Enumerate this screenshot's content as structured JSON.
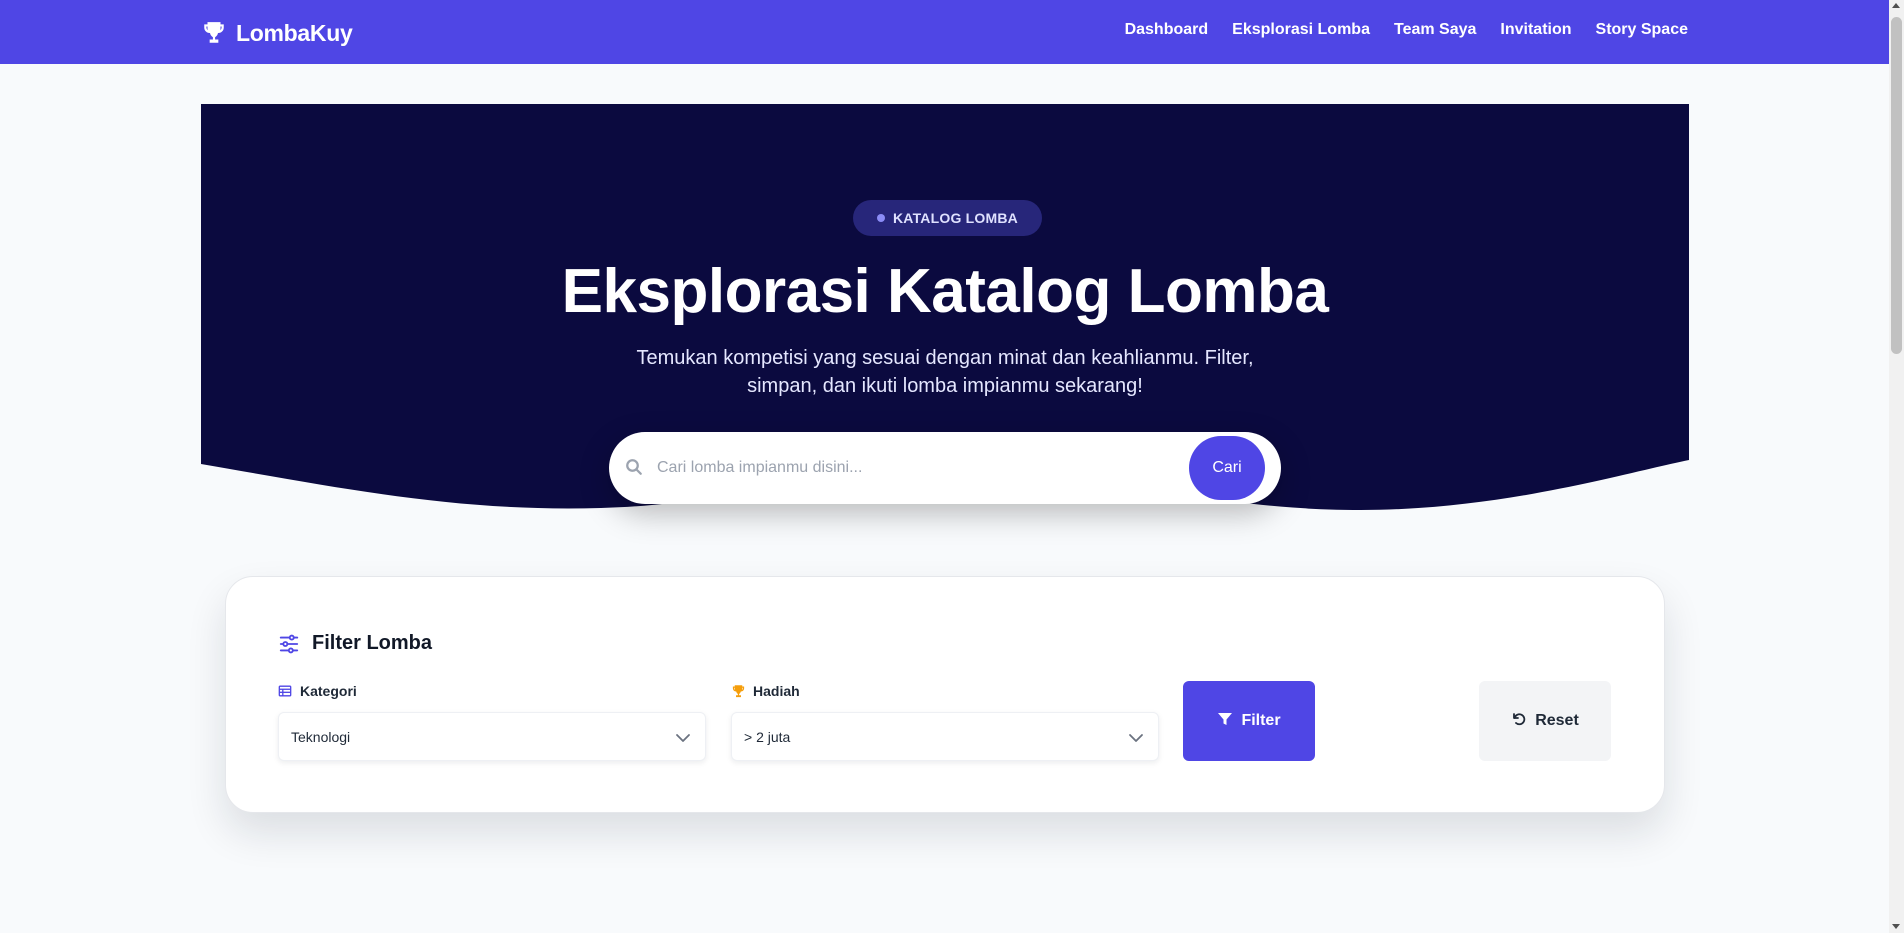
{
  "brand": {
    "name": "LombaKuy",
    "icon": "trophy-icon"
  },
  "nav": {
    "links": [
      "Dashboard",
      "Eksplorasi Lomba",
      "Team Saya",
      "Invitation",
      "Story Space"
    ]
  },
  "hero": {
    "badge": "KATALOG LOMBA",
    "title": "Eksplorasi Katalog Lomba",
    "subtitle": "Temukan kompetisi yang sesuai dengan minat dan keahlianmu. Filter, simpan, dan ikuti lomba impianmu sekarang!",
    "search": {
      "placeholder": "Cari lomba impianmu disini...",
      "value": "",
      "button": "Cari",
      "icon": "search-icon"
    }
  },
  "filter": {
    "title": "Filter Lomba",
    "icon": "sliders-icon",
    "kategori": {
      "label": "Kategori",
      "icon": "table-icon",
      "value": "Teknologi"
    },
    "hadiah": {
      "label": "Hadiah",
      "icon": "trophy-icon",
      "value": "> 2 juta"
    },
    "filter_button": "Filter",
    "reset_button": "Reset"
  },
  "colors": {
    "primary": "#4f46e5",
    "hero_bg": "#0b0a3f",
    "page_bg": "#f8fafc",
    "accent_gold": "#f59e0b"
  }
}
